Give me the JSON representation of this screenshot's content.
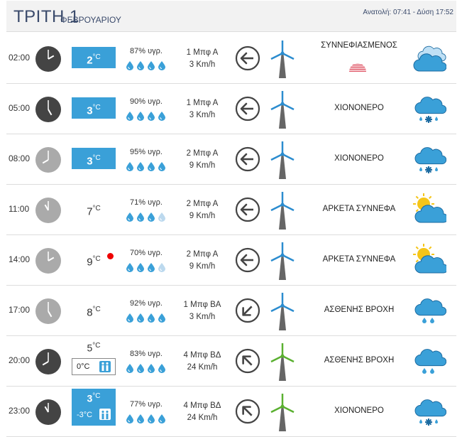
{
  "header": {
    "day": "ΤΡΙΤΗ 1",
    "month": "ΦΕΒΡΟΥΑΡΙΟΥ",
    "sun": "Ανατολή: 07:41  - Δύση 17:52"
  },
  "rows": [
    {
      "time": "02:00",
      "clock": "dark",
      "temp": "2",
      "unit": "°C",
      "cold": true,
      "hum": "87% υγρ.",
      "drops": 4,
      "wind_bft": "1 Μπφ Α",
      "wind_kmh": "3 Km/h",
      "dir": "east",
      "turbine": "blue",
      "cond": "ΣΥΝΝΕΦΙΑΣΜΕΝΟΣ",
      "icon": "cloudy-icon",
      "hatch": true
    },
    {
      "time": "05:00",
      "clock": "dark",
      "temp": "3",
      "unit": "°C",
      "cold": true,
      "hum": "90% υγρ.",
      "drops": 4,
      "wind_bft": "1 Μπφ Α",
      "wind_kmh": "3 Km/h",
      "dir": "east",
      "turbine": "blue",
      "cond": "ΧΙΟΝΟΝΕΡΟ",
      "icon": "sleet-icon"
    },
    {
      "time": "08:00",
      "clock": "light",
      "temp": "3",
      "unit": "°C",
      "cold": true,
      "hum": "95% υγρ.",
      "drops": 4,
      "wind_bft": "2 Μπφ Α",
      "wind_kmh": "9 Km/h",
      "dir": "east",
      "turbine": "blue",
      "cond": "ΧΙΟΝΟΝΕΡΟ",
      "icon": "sleet-icon"
    },
    {
      "time": "11:00",
      "clock": "light",
      "temp": "7",
      "unit": "°C",
      "cold": false,
      "hum": "71% υγρ.",
      "drops": 3,
      "wind_bft": "2 Μπφ Α",
      "wind_kmh": "9 Km/h",
      "dir": "east",
      "turbine": "blue",
      "cond": "ΑΡΚΕΤΑ ΣΥΝΝΕΦΑ",
      "icon": "partly-cloudy-icon"
    },
    {
      "time": "14:00",
      "clock": "light",
      "temp": "9",
      "unit": "°C",
      "cold": false,
      "hot": true,
      "hum": "70% υγρ.",
      "drops": 3,
      "wind_bft": "2 Μπφ Α",
      "wind_kmh": "9 Km/h",
      "dir": "east",
      "turbine": "blue",
      "cond": "ΑΡΚΕΤΑ ΣΥΝΝΕΦΑ",
      "icon": "partly-cloudy-icon"
    },
    {
      "time": "17:00",
      "clock": "light",
      "temp": "8",
      "unit": "°C",
      "cold": false,
      "hum": "92% υγρ.",
      "drops": 4,
      "wind_bft": "1 Μπφ ΒΑ",
      "wind_kmh": "3 Km/h",
      "dir": "northeast",
      "turbine": "blue",
      "cond": "ΑΣΘΕΝΗΣ ΒΡΟΧΗ",
      "icon": "light-rain-icon"
    },
    {
      "time": "20:00",
      "clock": "dark",
      "temp": "5",
      "unit": "°C",
      "cold": false,
      "feel": "0°C",
      "hum": "83% υγρ.",
      "drops": 4,
      "wind_bft": "4 Μπφ ΒΔ",
      "wind_kmh": "24 Km/h",
      "dir": "northwest",
      "turbine": "green",
      "cond": "ΑΣΘΕΝΗΣ ΒΡΟΧΗ",
      "icon": "light-rain-icon"
    },
    {
      "time": "23:00",
      "clock": "dark",
      "temp": "3",
      "unit": "°C",
      "cold": true,
      "feel": "-3°C",
      "hum": "77% υγρ.",
      "drops": 4,
      "wind_bft": "4 Μπφ ΒΔ",
      "wind_kmh": "24 Km/h",
      "dir": "northwest",
      "turbine": "green",
      "cond": "ΧΙΟΝΟΝΕΡΟ",
      "icon": "sleet-icon"
    }
  ],
  "colors": {
    "cold": "#3aa0d8",
    "drop": "#3aa0d8",
    "drop_light": "#bcd9ee",
    "turbine_blue": "#2b8ccf",
    "turbine_green": "#5ab030",
    "clock_dark": "#444444",
    "clock_light": "#aaaaaa"
  }
}
